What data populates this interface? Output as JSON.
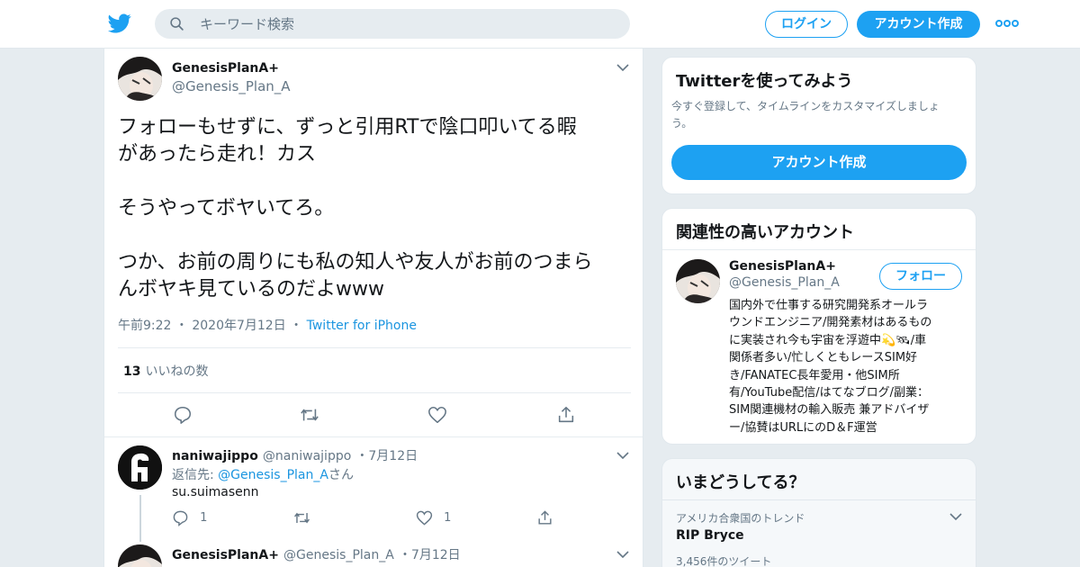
{
  "header": {
    "search_placeholder": "キーワード検索",
    "login_label": "ログイン",
    "signup_label": "アカウント作成"
  },
  "tweet": {
    "author_name": "GenesisPlanA+",
    "author_handle": "@Genesis_Plan_A",
    "paragraphs": [
      [
        "フォローもせずに、ずっと引用RTで陰口叩いてる暇",
        "があったら走れ！カス"
      ],
      [
        "そうやってボヤいてろ。"
      ],
      [
        "つか、お前の周りにも私の知人や友人がお前のつまら",
        "んボヤキ見ているのだよwww"
      ]
    ],
    "time": "午前9:22",
    "date": "2020年7月12日",
    "source": "Twitter for iPhone",
    "like_count": "13",
    "like_label": "いいねの数"
  },
  "reply1": {
    "name": "naniwajippo",
    "handle": "@naniwajippo",
    "date": "7月12日",
    "reply_prefix": "返信先: ",
    "reply_to": "@Genesis_Plan_A",
    "reply_suffix": "さん",
    "text": "su.suimasenn",
    "reply_count": "1",
    "like_count": "1"
  },
  "reply2": {
    "name": "GenesisPlanA+",
    "handle": "@Genesis_Plan_A",
    "date": "7月12日"
  },
  "signup_card": {
    "title": "Twitterを使ってみよう",
    "desc_line1": "今すぐ登録して、タイムラインをカスタマイズしましょ",
    "desc_line2": "う。",
    "button_label": "アカウント作成"
  },
  "related_card": {
    "title": "関連性の高いアカウント",
    "name": "GenesisPlanA+",
    "handle": "@Genesis_Plan_A",
    "follow_label": "フォロー",
    "bio_lines": [
      "国内外で仕事する研究開発系オールラ",
      "ウンドエンジニア/開発素材はあるもの",
      "に実装され今も宇宙を浮遊中💫🛰/車",
      "関係者多い/忙しくともレースSIM好",
      "き/FANATEC長年愛用・他SIM所",
      "有/YouTube配信/はてなブログ/副業：",
      "SIM関連機材の輸入販売 兼アドバイザ",
      "ー/協賛はURLにのD＆F運営"
    ]
  },
  "trends_card": {
    "title": "いまどうしてる？",
    "context": "アメリカ合衆国のトレンド",
    "trend_name": "RIP Bryce",
    "tweet_count": "3,456件のツイート"
  },
  "colors": {
    "accent": "#1da1f2",
    "link": "#1b95e0",
    "muted": "#657786",
    "background": "#e6ecf0"
  },
  "icons": [
    "twitter-bird-icon",
    "search-icon",
    "more-dots-icon",
    "chevron-down-icon",
    "reply-icon",
    "retweet-icon",
    "heart-icon",
    "share-icon"
  ]
}
